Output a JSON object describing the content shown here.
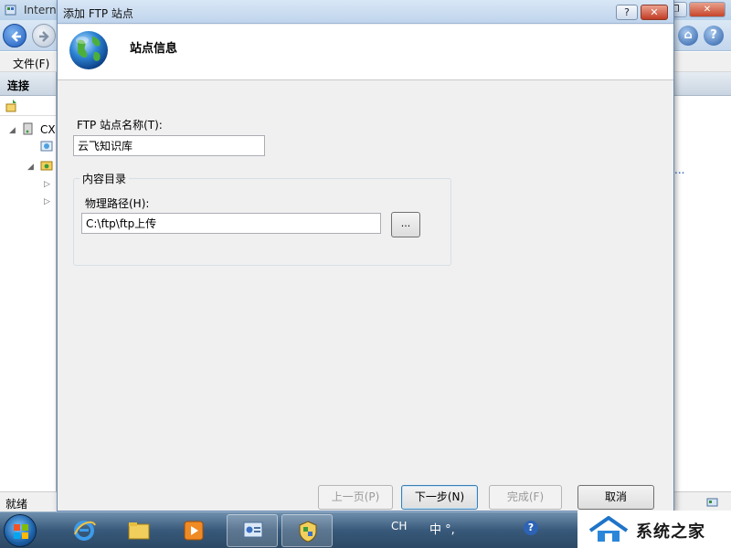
{
  "background_window": {
    "title": "Intern",
    "menu_file": "文件(F)",
    "left_pane_header": "连接",
    "tree_root": "CX",
    "right_pane_ellipsis": "...",
    "status": "就绪"
  },
  "dialog": {
    "title": "添加 FTP 站点",
    "help_label": "?",
    "close_label": "✕",
    "header_title": "站点信息",
    "site_name_label": "FTP 站点名称(T):",
    "site_name_value": "云飞知识库",
    "content_dir_legend": "内容目录",
    "physical_path_label": "物理路径(H):",
    "physical_path_value": "C:\\ftp\\ftp上传",
    "browse_label": "...",
    "buttons": {
      "prev": "上一页(P)",
      "next": "下一步(N)",
      "finish": "完成(F)",
      "cancel": "取消"
    }
  },
  "taskbar": {
    "lang": "CH",
    "ime": "中 °,",
    "help": "?"
  },
  "watermark": {
    "text": "系统之家"
  },
  "colors": {
    "dialog_bg": "#f0f0f0",
    "title_gradient_top": "#d9e7f6",
    "close_red": "#c23c24",
    "taskbar": "#39597a"
  }
}
